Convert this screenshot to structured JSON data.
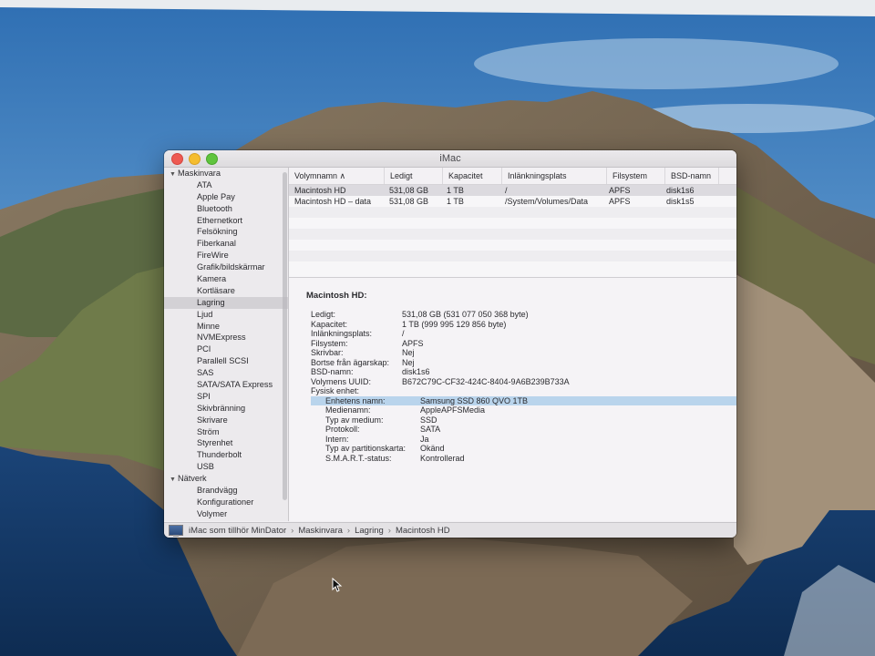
{
  "window": {
    "title": "iMac"
  },
  "sidebar": {
    "groups": [
      {
        "label": "Maskinvara",
        "items": [
          "ATA",
          "Apple Pay",
          "Bluetooth",
          "Ethernetkort",
          "Felsökning",
          "Fiberkanal",
          "FireWire",
          "Grafik/bildskärmar",
          "Kamera",
          "Kortläsare",
          "Lagring",
          "Ljud",
          "Minne",
          "NVMExpress",
          "PCI",
          "Parallell SCSI",
          "SAS",
          "SATA/SATA Express",
          "SPI",
          "Skivbränning",
          "Skrivare",
          "Ström",
          "Styrenhet",
          "Thunderbolt",
          "USB"
        ]
      },
      {
        "label": "Nätverk",
        "items": [
          "Brandvägg",
          "Konfigurationer",
          "Volymer"
        ]
      }
    ],
    "selected": "Lagring"
  },
  "volumes": {
    "columns": [
      "Volymnamn",
      "Ledigt",
      "Kapacitet",
      "Inlänkningsplats",
      "Filsystem",
      "BSD-namn"
    ],
    "rows": [
      [
        "Macintosh HD",
        "531,08 GB",
        "1 TB",
        "/",
        "APFS",
        "disk1s6"
      ],
      [
        "Macintosh HD – data",
        "531,08 GB",
        "1 TB",
        "/System/Volumes/Data",
        "APFS",
        "disk1s5"
      ]
    ]
  },
  "detail": {
    "title": "Macintosh HD:",
    "fields": [
      {
        "k": "Ledigt:",
        "v": "531,08 GB (531 077 050 368 byte)"
      },
      {
        "k": "Kapacitet:",
        "v": "1 TB (999 995 129 856 byte)"
      },
      {
        "k": "Inlänkningsplats:",
        "v": "/"
      },
      {
        "k": "Filsystem:",
        "v": "APFS"
      },
      {
        "k": "Skrivbar:",
        "v": "Nej"
      },
      {
        "k": "Bortse från ägarskap:",
        "v": "Nej"
      },
      {
        "k": "BSD-namn:",
        "v": "disk1s6"
      },
      {
        "k": "Volymens UUID:",
        "v": "B672C79C-CF32-424C-8404-9A6B239B733A"
      },
      {
        "k": "Fysisk enhet:",
        "v": ""
      }
    ],
    "physical": [
      {
        "k": "Enhetens namn:",
        "v": "Samsung SSD 860 QVO 1TB"
      },
      {
        "k": "Medienamn:",
        "v": "AppleAPFSMedia"
      },
      {
        "k": "Typ av medium:",
        "v": "SSD"
      },
      {
        "k": "Protokoll:",
        "v": "SATA"
      },
      {
        "k": "Intern:",
        "v": "Ja"
      },
      {
        "k": "Typ av partitionskarta:",
        "v": "Okänd"
      },
      {
        "k": "S.M.A.R.T.-status:",
        "v": "Kontrollerad"
      }
    ]
  },
  "pathbar": {
    "crumbs": [
      "iMac som tillhör MinDator",
      "Maskinvara",
      "Lagring",
      "Macintosh HD"
    ]
  },
  "colors": {
    "sky": "#4f86c2",
    "window_bg": "#f1eff2",
    "selection_blue": "#b9d4ec"
  }
}
